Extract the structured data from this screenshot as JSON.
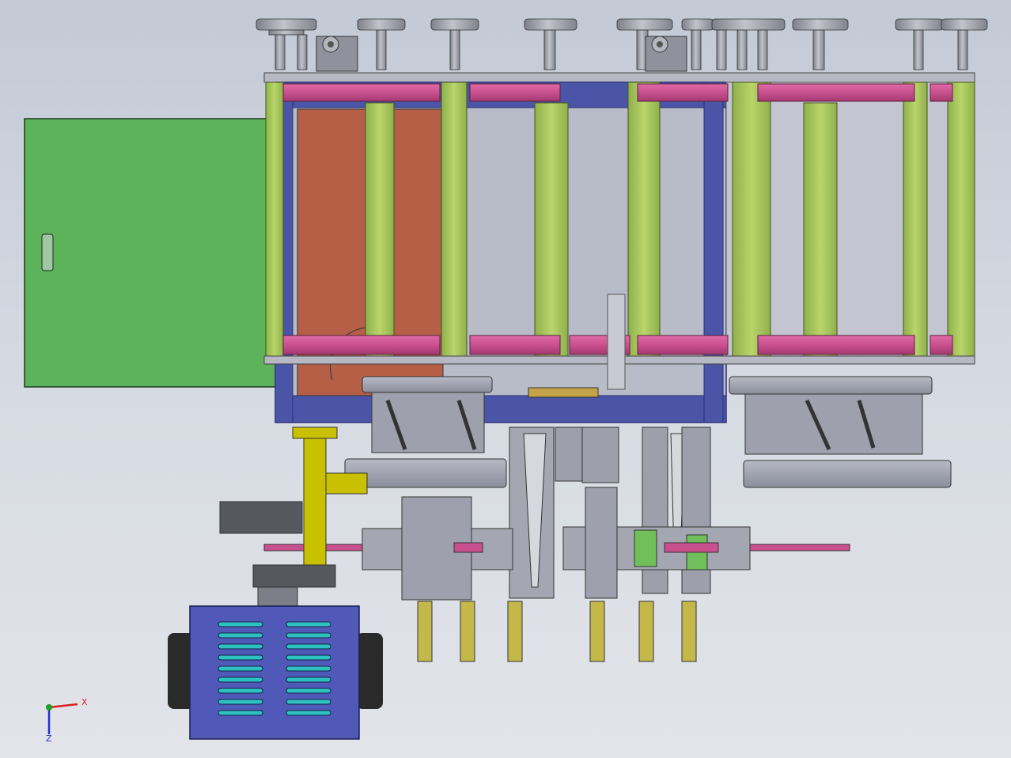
{
  "view": {
    "triad_axes": {
      "x": "X",
      "z": "Z"
    }
  },
  "colors": {
    "background_top": "#c3cad6",
    "frame_green": "#a9c95c",
    "beam_pink": "#c8508f",
    "panel_orange": "#b55f47",
    "door_green": "#5db35a",
    "aluminum_blue": "#4b55a8",
    "gray_metal": "#9ea1ad",
    "dark_metal": "#55585f",
    "cabinet_blue": "#5058b8",
    "vent_teal": "#2ec1c1",
    "yellow_pipe": "#c9c000",
    "axis_x": "#d92020",
    "axis_y": "#20a020",
    "axis_z": "#2030d0"
  }
}
